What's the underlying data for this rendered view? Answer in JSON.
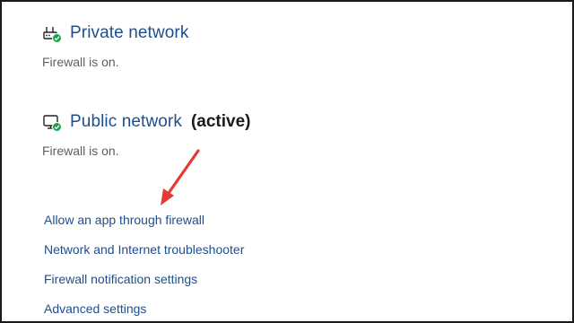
{
  "private_network": {
    "title": "Private network",
    "status": "Firewall is on.",
    "icon": "private-network-icon"
  },
  "public_network": {
    "title": "Public network",
    "active_label": "(active)",
    "status": "Firewall is on.",
    "icon": "public-network-icon"
  },
  "links": [
    {
      "label": "Allow an app through firewall"
    },
    {
      "label": "Network and Internet troubleshooter"
    },
    {
      "label": "Firewall notification settings"
    },
    {
      "label": "Advanced settings"
    }
  ],
  "colors": {
    "link": "#1f4e8c",
    "status_text": "#5f5f5f",
    "check_badge": "#16a34a",
    "annotation_arrow": "#e53935"
  }
}
